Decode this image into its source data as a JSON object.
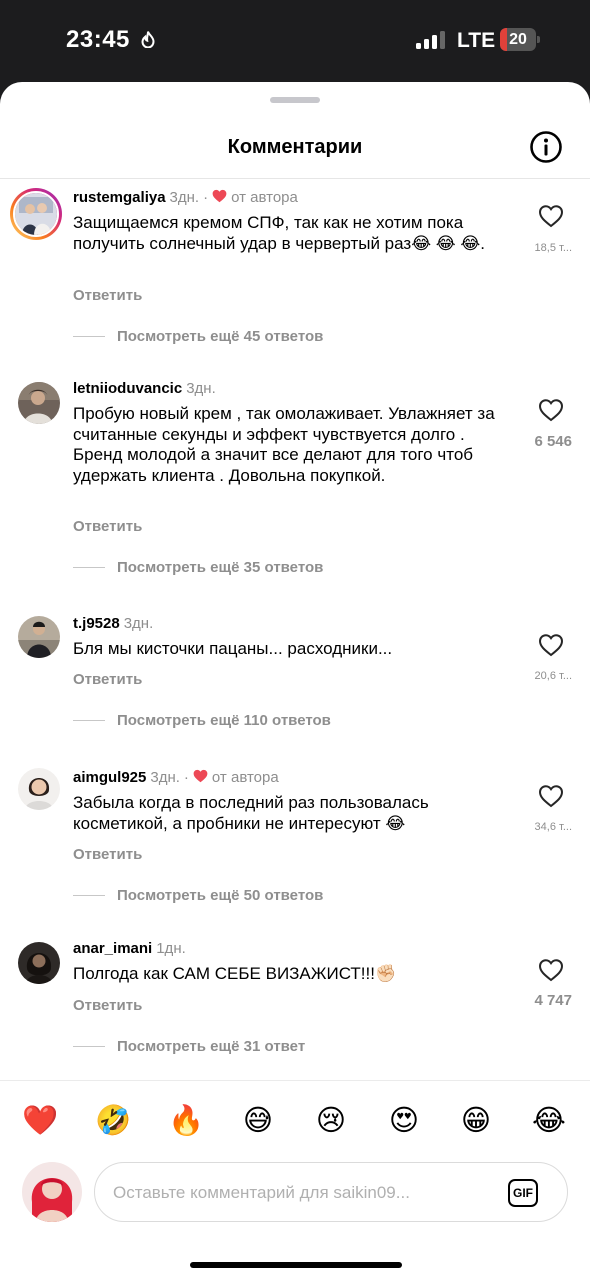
{
  "status_bar": {
    "time": "23:45",
    "network": "LTE",
    "battery": "20",
    "battery_level": 0.2
  },
  "sheet": {
    "title": "Комментарии"
  },
  "comments": [
    {
      "username": "rustemgaliya",
      "time": "3дн.",
      "liked_by_author": true,
      "author_label": "от автора",
      "text": "Защищаемся кремом СПФ, так как не хотим пока получить солнечный удар в червертый раз😂 😂 😂.",
      "reply_label": "Ответить",
      "view_replies": "Посмотреть ещё 45 ответов",
      "likes": "18,5 т..."
    },
    {
      "username": "letniioduvancic",
      "time": "3дн.",
      "liked_by_author": false,
      "author_label": "",
      "text": "Пробую новый крем , так омолаживает. Увлажняет за считанные секунды  и эффект чувствуется  долго . Бренд молодой а значит все делают для того чтоб удержать клиента . Довольна покупкой.",
      "reply_label": "Ответить",
      "view_replies": "Посмотреть ещё 35 ответов",
      "likes": "6 546"
    },
    {
      "username": "t.j9528",
      "time": "3дн.",
      "liked_by_author": false,
      "author_label": "",
      "text": "Бля мы кисточки пацаны... расходники...",
      "reply_label": "Ответить",
      "view_replies": "Посмотреть ещё 110 ответов",
      "likes": "20,6 т..."
    },
    {
      "username": "aimgul925",
      "time": "3дн.",
      "liked_by_author": true,
      "author_label": "от автора",
      "text": "Забыла когда в последний раз пользовалась косметикой, а пробники не интересуют 😂",
      "reply_label": "Ответить",
      "view_replies": "Посмотреть ещё 50 ответов",
      "likes": "34,6 т..."
    },
    {
      "username": "anar_imani",
      "time": "1дн.",
      "liked_by_author": false,
      "author_label": "",
      "text": "Полгода как САМ СЕБЕ ВИЗАЖИСТ!!!✊🏻",
      "reply_label": "Ответить",
      "view_replies": "Посмотреть ещё 31 ответ",
      "likes": "4 747"
    }
  ],
  "reactions": [
    "❤️",
    "🤣",
    "🔥",
    "😅",
    "😢",
    "😍",
    "😁",
    "😂"
  ],
  "composer": {
    "placeholder": "Оставьте комментарий для saikin09...",
    "gif_label": "GIF"
  },
  "colors": {
    "heart": "#ed4956",
    "secondary_text": "#8e8e8e",
    "battery_red": "#e0413a"
  },
  "icons": [
    "flame-icon",
    "signal-icon",
    "info-icon",
    "heart-outline-icon",
    "heart-filled-icon",
    "gif-icon"
  ]
}
